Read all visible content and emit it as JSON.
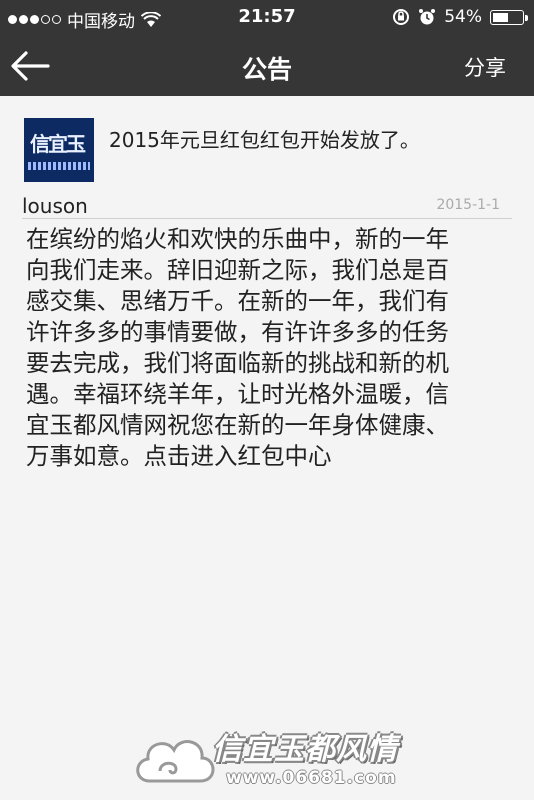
{
  "status_bar": {
    "carrier": "中国移动",
    "time": "21:57",
    "battery_percent": "54%",
    "battery_level": 0.54
  },
  "nav": {
    "title": "公告",
    "share_label": "分享"
  },
  "post": {
    "headline": "2015年元旦红包红包开始发放了。",
    "author": "louson",
    "date": "2015-1-1",
    "body_lines": [
      "在缤纷的焰火和欢快的乐曲中，新的一年",
      "向我们走来。辞旧迎新之际，我们总是百",
      "感交集、思绪万千。在新的一年，我们有",
      "许许多多的事情要做，有许许多多的任务",
      "要去完成，我们将面临新的挑战和新的机",
      "遇。幸福环绕羊年，让时光格外温暖，信",
      "宜玉都风情网祝您在新的一年身体健康、",
      "万事如意。点击进入红包中心"
    ]
  },
  "watermark": {
    "name": "信宜玉都风情",
    "url": "www.06681.com"
  },
  "icons": {
    "back": "back-arrow-icon",
    "wifi": "wifi-icon",
    "lock": "orientation-lock-icon",
    "alarm": "alarm-icon",
    "battery": "battery-icon"
  }
}
